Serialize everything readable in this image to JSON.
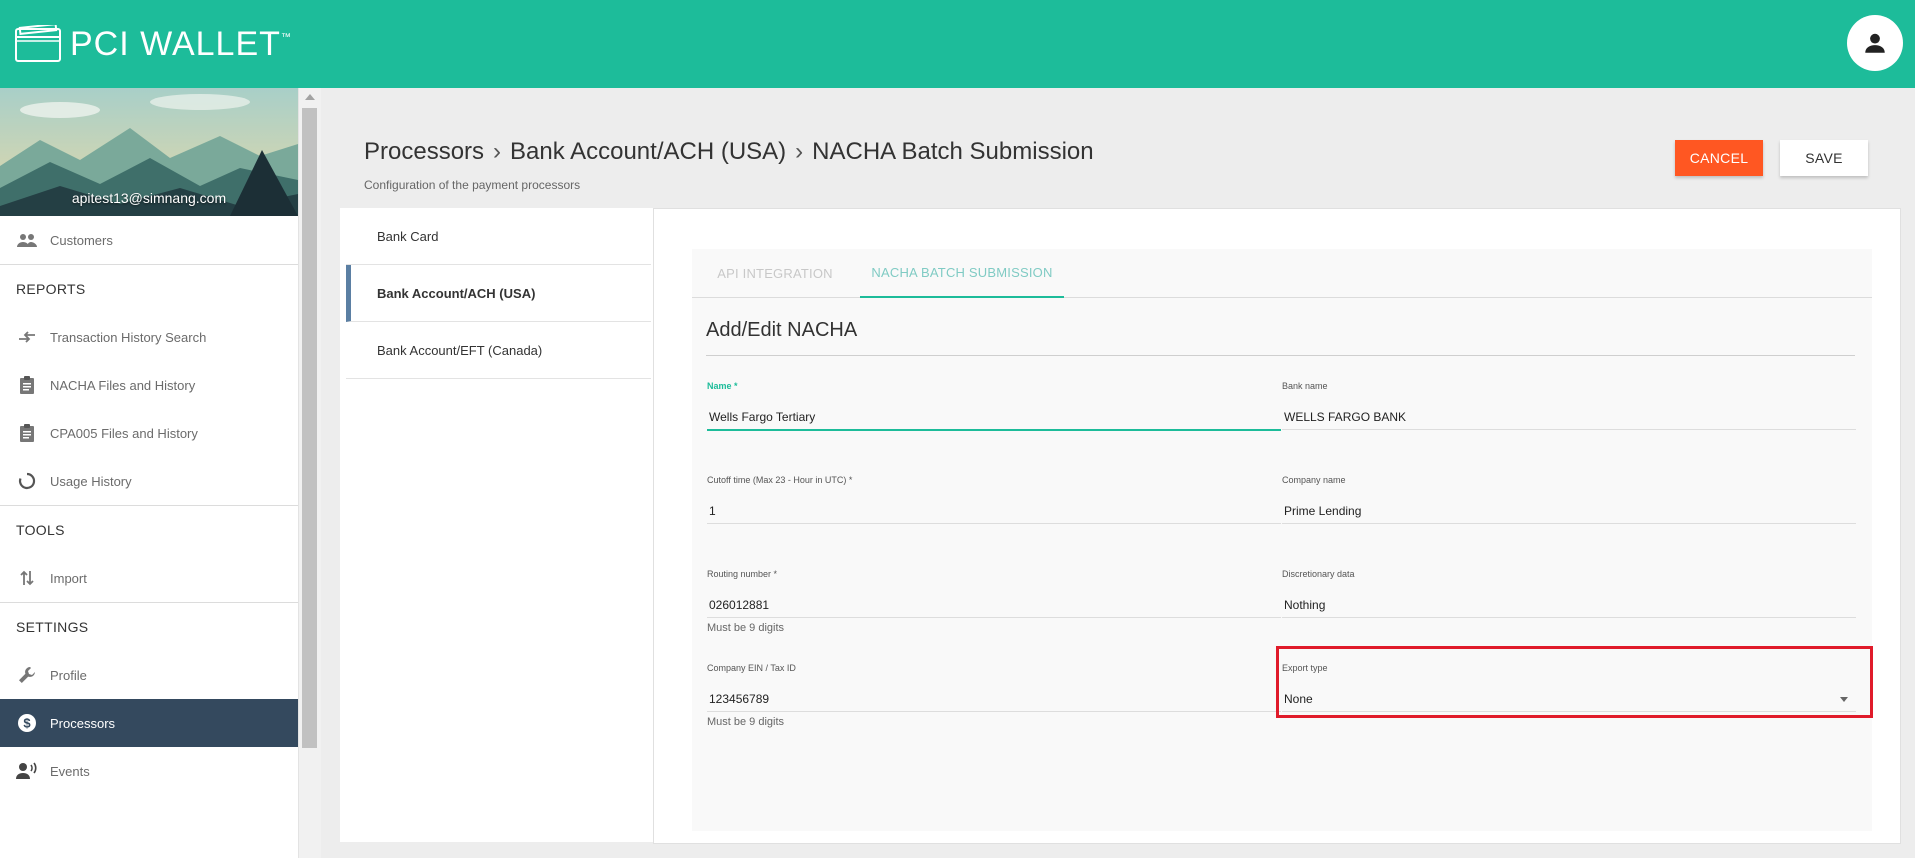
{
  "brand": {
    "name": "PCI WALLET",
    "tm": "™",
    "accent": "#1dbc9a"
  },
  "user": {
    "email": "apitest13@simnang.com"
  },
  "sidebar": {
    "items": [
      {
        "label": "Customers",
        "icon": "people-icon"
      },
      {
        "section": "REPORTS"
      },
      {
        "label": "Transaction History Search",
        "icon": "swap-arrows-icon"
      },
      {
        "label": "NACHA Files and History",
        "icon": "clipboard-icon"
      },
      {
        "label": "CPA005 Files and History",
        "icon": "clipboard-icon"
      },
      {
        "label": "Usage History",
        "icon": "circle-progress-icon"
      },
      {
        "section": "TOOLS"
      },
      {
        "label": "Import",
        "icon": "import-arrows-icon"
      },
      {
        "section": "SETTINGS"
      },
      {
        "label": "Profile",
        "icon": "wrench-icon"
      },
      {
        "label": "Processors",
        "icon": "dollar-circle-icon",
        "active": true
      },
      {
        "label": "Events",
        "icon": "speaker-person-icon"
      }
    ]
  },
  "header": {
    "breadcrumb": [
      "Processors",
      "Bank Account/ACH (USA)",
      "NACHA Batch Submission"
    ],
    "subtitle": "Configuration of the payment processors",
    "cancel_label": "CANCEL",
    "save_label": "SAVE",
    "cancel_color": "#ff5722"
  },
  "processors": {
    "items": [
      {
        "label": "Bank Card"
      },
      {
        "label": "Bank Account/ACH (USA)",
        "active": true
      },
      {
        "label": "Bank Account/EFT (Canada)"
      }
    ]
  },
  "tabs": [
    {
      "label": "API INTEGRATION"
    },
    {
      "label": "NACHA BATCH SUBMISSION",
      "active": true
    }
  ],
  "form": {
    "title": "Add/Edit NACHA",
    "name": {
      "label": "Name",
      "required": "*",
      "value": "Wells Fargo Tertiary"
    },
    "bank_name": {
      "label": "Bank name",
      "value": "WELLS FARGO BANK"
    },
    "cutoff": {
      "label": "Cutoff time (Max 23 - Hour in UTC) *",
      "value": "1"
    },
    "company_name": {
      "label": "Company name",
      "value": "Prime Lending"
    },
    "routing": {
      "label": "Routing number *",
      "value": "026012881",
      "hint": "Must be 9 digits"
    },
    "discretionary": {
      "label": "Discretionary data",
      "value": "Nothing"
    },
    "ein": {
      "label": "Company EIN / Tax ID",
      "value": "123456789",
      "hint": "Must be 9 digits"
    },
    "export_type": {
      "label": "Export type",
      "value": "None"
    }
  },
  "highlight_color": "#e01b2a"
}
